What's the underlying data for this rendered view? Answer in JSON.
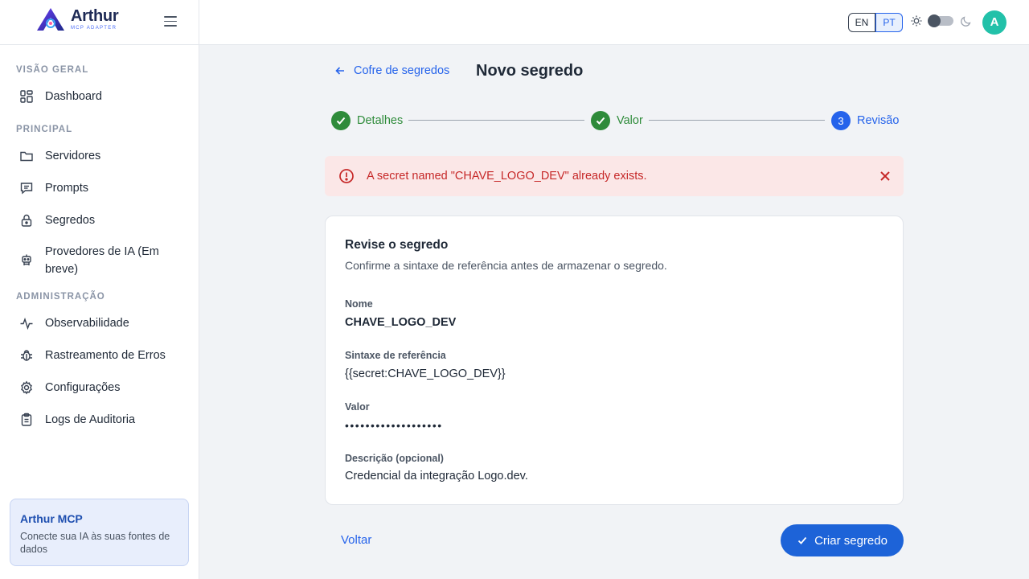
{
  "app": {
    "logo_title": "Arthur",
    "logo_subtitle": "MCP ADAPTER"
  },
  "sidebar": {
    "groups": [
      {
        "label": "VISÃO GERAL",
        "items": [
          {
            "label": "Dashboard",
            "icon": "dashboard-icon"
          }
        ]
      },
      {
        "label": "PRINCIPAL",
        "items": [
          {
            "label": "Servidores",
            "icon": "folder-icon"
          },
          {
            "label": "Prompts",
            "icon": "message-icon"
          },
          {
            "label": "Segredos",
            "icon": "lock-icon"
          },
          {
            "label": "Provedores de IA (Em breve)",
            "icon": "robot-icon"
          }
        ]
      },
      {
        "label": "ADMINISTRAÇÃO",
        "items": [
          {
            "label": "Observabilidade",
            "icon": "activity-icon"
          },
          {
            "label": "Rastreamento de Erros",
            "icon": "bug-icon"
          },
          {
            "label": "Configurações",
            "icon": "gear-icon"
          },
          {
            "label": "Logs de Auditoria",
            "icon": "clipboard-icon"
          }
        ]
      }
    ],
    "promo": {
      "title": "Arthur MCP",
      "text": "Conecte sua IA às suas fontes de dados"
    }
  },
  "topbar": {
    "lang_en": "EN",
    "lang_pt": "PT",
    "selected_lang": "PT",
    "theme_dark": false,
    "avatar_initial": "A"
  },
  "page": {
    "back_label": "Cofre de segredos",
    "title": "Novo segredo",
    "steps": [
      {
        "label": "Detalhes",
        "state": "done"
      },
      {
        "label": "Valor",
        "state": "done"
      },
      {
        "label": "Revisão",
        "state": "current",
        "number": "3"
      }
    ],
    "alert": "A secret named \"CHAVE_LOGO_DEV\" already exists.",
    "card": {
      "title": "Revise o segredo",
      "subtitle": "Confirme a sintaxe de referência antes de armazenar o segredo.",
      "fields": [
        {
          "label": "Nome",
          "value": "CHAVE_LOGO_DEV"
        },
        {
          "label": "Sintaxe de referência",
          "value": "{{secret:CHAVE_LOGO_DEV}}"
        },
        {
          "label": "Valor",
          "value": "•••••••••••••••••••"
        },
        {
          "label": "Descrição (opcional)",
          "value": "Credencial da integração Logo.dev."
        }
      ]
    },
    "back_button": "Voltar",
    "submit_button": "Criar segredo"
  },
  "colors": {
    "accent": "#1d63d8",
    "success": "#2e8b3a",
    "error": "#c62828",
    "avatar": "#22c1a9"
  }
}
